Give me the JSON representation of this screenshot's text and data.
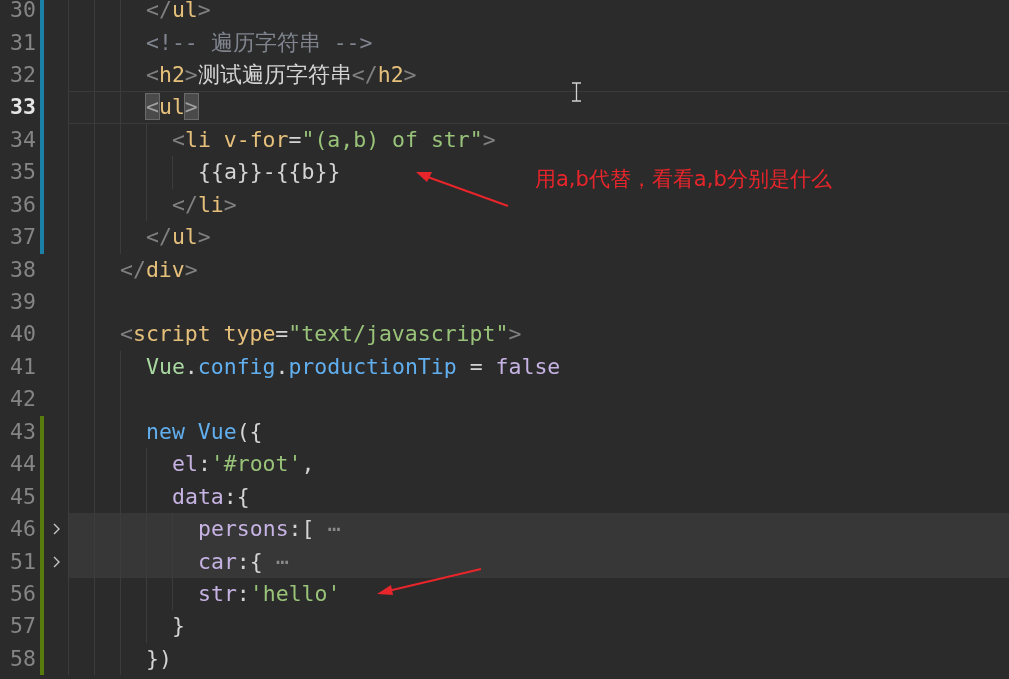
{
  "editor": {
    "lines": [
      {
        "number": "30",
        "color": "#1b81a8",
        "current": false,
        "folded": false,
        "guides": [
          {
            "kind": "guide"
          },
          {
            "kind": "guide"
          },
          {
            "kind": "guide"
          }
        ],
        "tokens": [
          {
            "kind": "punct",
            "text": "</"
          },
          {
            "kind": "tag",
            "text": "ul"
          },
          {
            "kind": "punct",
            "text": ">"
          }
        ]
      },
      {
        "number": "31",
        "color": "#1b81a8",
        "current": false,
        "folded": false,
        "guides": [
          {
            "kind": "guide"
          },
          {
            "kind": "guide"
          },
          {
            "kind": "guide"
          }
        ],
        "tokens": [
          {
            "kind": "comment",
            "text": "<!-- 遍历字符串 -->"
          }
        ]
      },
      {
        "number": "32",
        "color": "#1b81a8",
        "current": false,
        "folded": false,
        "guides": [
          {
            "kind": "guide"
          },
          {
            "kind": "guide"
          },
          {
            "kind": "guide"
          }
        ],
        "tokens": [
          {
            "kind": "punct",
            "text": "<"
          },
          {
            "kind": "tag",
            "text": "h2"
          },
          {
            "kind": "punct",
            "text": ">"
          },
          {
            "kind": "text",
            "text": "测试遍历字符串"
          },
          {
            "kind": "punct",
            "text": "</"
          },
          {
            "kind": "tag",
            "text": "h2"
          },
          {
            "kind": "punct",
            "text": ">"
          }
        ]
      },
      {
        "number": "33",
        "color": "#1b81a8",
        "current": true,
        "folded": false,
        "guides": [
          {
            "kind": "guide"
          },
          {
            "kind": "guide"
          },
          {
            "kind": "guide"
          }
        ],
        "tokens": [
          {
            "kind": "bracket-match",
            "text": "<"
          },
          {
            "kind": "tag",
            "text": "ul"
          },
          {
            "kind": "bracket-match",
            "text": ">"
          }
        ]
      },
      {
        "number": "34",
        "color": "#1b81a8",
        "current": false,
        "folded": false,
        "guides": [
          {
            "kind": "guide"
          },
          {
            "kind": "guide"
          },
          {
            "kind": "guide"
          },
          {
            "kind": "guide"
          }
        ],
        "tokens": [
          {
            "kind": "punct",
            "text": "<"
          },
          {
            "kind": "tag",
            "text": "li"
          },
          {
            "kind": "attr",
            "text": " v-for"
          },
          {
            "kind": "text",
            "text": "="
          },
          {
            "kind": "string",
            "text": "\"(a,b) of str\""
          },
          {
            "kind": "punct",
            "text": ">"
          }
        ]
      },
      {
        "number": "35",
        "color": "#1b81a8",
        "current": false,
        "folded": false,
        "guides": [
          {
            "kind": "guide"
          },
          {
            "kind": "guide"
          },
          {
            "kind": "guide"
          },
          {
            "kind": "guide"
          },
          {
            "kind": "guide"
          }
        ],
        "tokens": [
          {
            "kind": "text",
            "text": "{{a}}-{{b}}"
          }
        ]
      },
      {
        "number": "36",
        "color": "#1b81a8",
        "current": false,
        "folded": false,
        "guides": [
          {
            "kind": "guide"
          },
          {
            "kind": "guide"
          },
          {
            "kind": "guide"
          },
          {
            "kind": "guide"
          }
        ],
        "tokens": [
          {
            "kind": "punct",
            "text": "</"
          },
          {
            "kind": "tag",
            "text": "li"
          },
          {
            "kind": "punct",
            "text": ">"
          }
        ]
      },
      {
        "number": "37",
        "color": "#1b81a8",
        "current": false,
        "folded": false,
        "guides": [
          {
            "kind": "guide"
          },
          {
            "kind": "guide"
          },
          {
            "kind": "guide"
          }
        ],
        "tokens": [
          {
            "kind": "punct",
            "text": "</"
          },
          {
            "kind": "tag",
            "text": "ul"
          },
          {
            "kind": "punct",
            "text": ">"
          }
        ]
      },
      {
        "number": "38",
        "current": false,
        "folded": false,
        "guides": [
          {
            "kind": "guide"
          },
          {
            "kind": "guide"
          }
        ],
        "tokens": [
          {
            "kind": "punct",
            "text": "</"
          },
          {
            "kind": "tag",
            "text": "div"
          },
          {
            "kind": "punct",
            "text": ">"
          }
        ]
      },
      {
        "number": "39",
        "current": false,
        "folded": false,
        "guides": [
          {
            "kind": "guide"
          },
          {
            "kind": "guide"
          }
        ]
      },
      {
        "number": "40",
        "current": false,
        "folded": false,
        "guides": [
          {
            "kind": "guide"
          },
          {
            "kind": "guide"
          }
        ],
        "tokens": [
          {
            "kind": "punct",
            "text": "<"
          },
          {
            "kind": "tag",
            "text": "script"
          },
          {
            "kind": "attr",
            "text": " type"
          },
          {
            "kind": "text",
            "text": "="
          },
          {
            "kind": "string",
            "text": "\"text/javascript\""
          },
          {
            "kind": "punct",
            "text": ">"
          }
        ]
      },
      {
        "number": "41",
        "current": false,
        "folded": false,
        "guides": [
          {
            "kind": "guide"
          },
          {
            "kind": "guide"
          },
          {
            "kind": "guide"
          }
        ],
        "tokens": [
          {
            "kind": "class",
            "text": "Vue"
          },
          {
            "kind": "text",
            "text": "."
          },
          {
            "kind": "prop",
            "text": "config"
          },
          {
            "kind": "text",
            "text": "."
          },
          {
            "kind": "prop",
            "text": "productionTip"
          },
          {
            "kind": "text",
            "text": " = "
          },
          {
            "kind": "key",
            "text": "false"
          }
        ]
      },
      {
        "number": "42",
        "current": false,
        "folded": false,
        "guides": [
          {
            "kind": "guide"
          },
          {
            "kind": "guide"
          },
          {
            "kind": "guide"
          }
        ]
      },
      {
        "number": "43",
        "color": "#587c0c",
        "current": false,
        "folded": false,
        "guides": [
          {
            "kind": "guide"
          },
          {
            "kind": "guide"
          },
          {
            "kind": "guide"
          }
        ],
        "tokens": [
          {
            "kind": "keyword",
            "text": "new"
          },
          {
            "kind": "prop",
            "text": " Vue"
          },
          {
            "kind": "text",
            "text": "({"
          }
        ]
      },
      {
        "number": "44",
        "color": "#587c0c",
        "current": false,
        "folded": false,
        "guides": [
          {
            "kind": "guide"
          },
          {
            "kind": "guide"
          },
          {
            "kind": "guide"
          },
          {
            "kind": "guide"
          }
        ],
        "tokens": [
          {
            "kind": "key",
            "text": "el"
          },
          {
            "kind": "text",
            "text": ":"
          },
          {
            "kind": "string",
            "text": "'#root'"
          },
          {
            "kind": "text",
            "text": ","
          }
        ]
      },
      {
        "number": "45",
        "color": "#587c0c",
        "current": false,
        "folded": false,
        "guides": [
          {
            "kind": "guide"
          },
          {
            "kind": "guide"
          },
          {
            "kind": "guide"
          },
          {
            "kind": "guide"
          }
        ],
        "tokens": [
          {
            "kind": "key",
            "text": "data"
          },
          {
            "kind": "text",
            "text": ":{"
          }
        ]
      },
      {
        "number": "46",
        "color": "#587c0c",
        "current": false,
        "folded": true,
        "guides": [
          {
            "kind": "guide"
          },
          {
            "kind": "guide"
          },
          {
            "kind": "guide"
          },
          {
            "kind": "guide"
          },
          {
            "kind": "guide"
          }
        ],
        "tokens": [
          {
            "kind": "key",
            "text": "persons"
          },
          {
            "kind": "text",
            "text": ":["
          },
          {
            "kind": "fold",
            "text": " ⋯"
          }
        ]
      },
      {
        "number": "51",
        "color": "#587c0c",
        "current": false,
        "folded": true,
        "guides": [
          {
            "kind": "guide"
          },
          {
            "kind": "guide"
          },
          {
            "kind": "guide"
          },
          {
            "kind": "guide"
          },
          {
            "kind": "guide"
          }
        ],
        "tokens": [
          {
            "kind": "key",
            "text": "car"
          },
          {
            "kind": "text",
            "text": ":{"
          },
          {
            "kind": "fold",
            "text": " ⋯"
          }
        ]
      },
      {
        "number": "56",
        "color": "#587c0c",
        "current": false,
        "folded": false,
        "guides": [
          {
            "kind": "guide"
          },
          {
            "kind": "guide"
          },
          {
            "kind": "guide"
          },
          {
            "kind": "guide"
          },
          {
            "kind": "guide"
          }
        ],
        "tokens": [
          {
            "kind": "key",
            "text": "str"
          },
          {
            "kind": "text",
            "text": ":"
          },
          {
            "kind": "string",
            "text": "'hello'"
          }
        ]
      },
      {
        "number": "57",
        "color": "#587c0c",
        "current": false,
        "folded": false,
        "guides": [
          {
            "kind": "guide"
          },
          {
            "kind": "guide"
          },
          {
            "kind": "guide"
          },
          {
            "kind": "guide"
          }
        ],
        "tokens": [
          {
            "kind": "text",
            "text": "}"
          }
        ]
      },
      {
        "number": "58",
        "color": "#587c0c",
        "current": false,
        "folded": false,
        "guides": [
          {
            "kind": "guide"
          },
          {
            "kind": "guide"
          },
          {
            "kind": "guide"
          }
        ],
        "tokens": [
          {
            "kind": "text",
            "text": "})"
          }
        ]
      }
    ]
  },
  "annotation": {
    "note": "用a,b代替，看看a,b分别是什么"
  }
}
